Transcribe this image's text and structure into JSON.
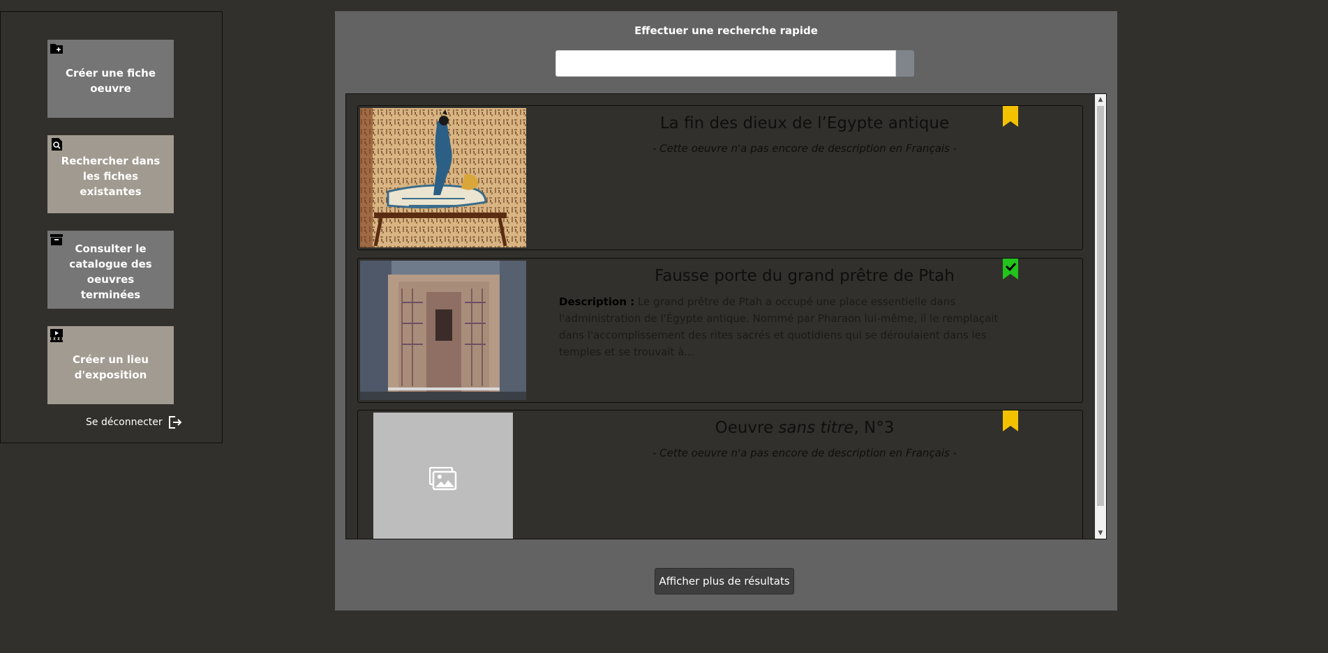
{
  "sidebar": {
    "cards": [
      {
        "label": "Créer une fiche\noeuvre",
        "icon": "folder-plus-icon"
      },
      {
        "label": "Rechercher dans\nles fiches existantes",
        "icon": "file-search-icon"
      },
      {
        "label": "Consulter le\ncatalogue des\noeuvres terminées",
        "icon": "archive-icon"
      },
      {
        "label": "Créer un lieu\nd'exposition",
        "icon": "exhibition-icon"
      }
    ],
    "logout_label": "Se déconnecter"
  },
  "search": {
    "title": "Effectuer une recherche rapide",
    "placeholder": ""
  },
  "results": [
    {
      "title": "La fin des dieux de l’Egypte antique",
      "description_empty": "- Cette oeuvre n'a pas encore de description en Français -",
      "bookmark": "bookmark-yellow-icon",
      "bookmark_color": "#f2c200"
    },
    {
      "title": "Fausse porte du grand prêtre de Ptah",
      "description_label": "Description :",
      "description": "Le grand prêtre de Ptah a occupé une place essentielle dans l'administration de l'Égypte antique. Nommé par Pharaon lui-même, il le remplaçait dans l'accomplissement des rites sacrés et quotidiens qui se déroulaient dans les temples et se trouvait à...",
      "bookmark": "bookmark-check-green-icon",
      "bookmark_color": "#22c31b"
    },
    {
      "title_prefix": "Oeuvre ",
      "title_italic": "sans titre",
      "title_suffix": ", N°3",
      "description_empty": "- Cette oeuvre n'a pas encore de description en Français -",
      "bookmark": "bookmark-yellow-icon",
      "bookmark_color": "#f2c200"
    }
  ],
  "more_button": "Afficher plus de résultats"
}
